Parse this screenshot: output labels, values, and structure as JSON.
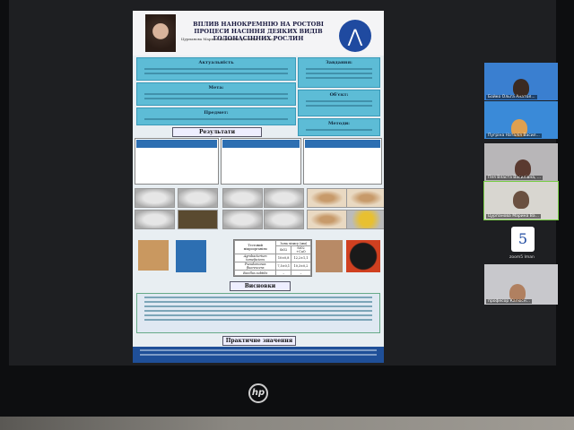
{
  "poster": {
    "title": "ВПЛИВ НАНОКРЕМНІЮ НА РОСТОВІ ПРОЦЕСИ НАСІННЯ ДЕЯКИХ ВИДІВ ГОЛОНАСІННИХ РОСЛИН",
    "author": "Цурпанова Марина Вадимівна, учениця 11 класу",
    "sections": {
      "relevance": "Актуальність",
      "goal": "Мета:",
      "subject": "Предмет:",
      "results": "Результати",
      "tasks": "Завдання:",
      "object": "Об'єкт:",
      "methods": "Методи:",
      "conclusions": "Висновки",
      "practical": "Практичне значення"
    },
    "micro_table": {
      "headers": [
        "Тестовий мікроорганізм",
        "Зона лізису (мм)"
      ],
      "subheaders": [
        "SiO2",
        "SiO2 +CuO"
      ],
      "rows": [
        [
          "Agrobacterium tumefaciens",
          "10±0,8",
          "12,2±1,1"
        ],
        [
          "Pseudomonas fluorescens",
          "7,5±0,1",
          "10,3±0,2"
        ],
        [
          "Bacillus subtilis",
          "–",
          "–"
        ]
      ]
    }
  },
  "participants": [
    {
      "name": "Бойко Ольга Анатол..."
    },
    {
      "name": "Пугріна Наталія Васил..."
    },
    {
      "name": "Пея Власта Василівна, ..."
    },
    {
      "name": "Цурпанова Марина Ва..."
    },
    {
      "name": "zoom5 Іman",
      "logo": "5"
    },
    {
      "name": "професор Калюсн..."
    }
  ],
  "monitor": {
    "brand": "hp"
  }
}
